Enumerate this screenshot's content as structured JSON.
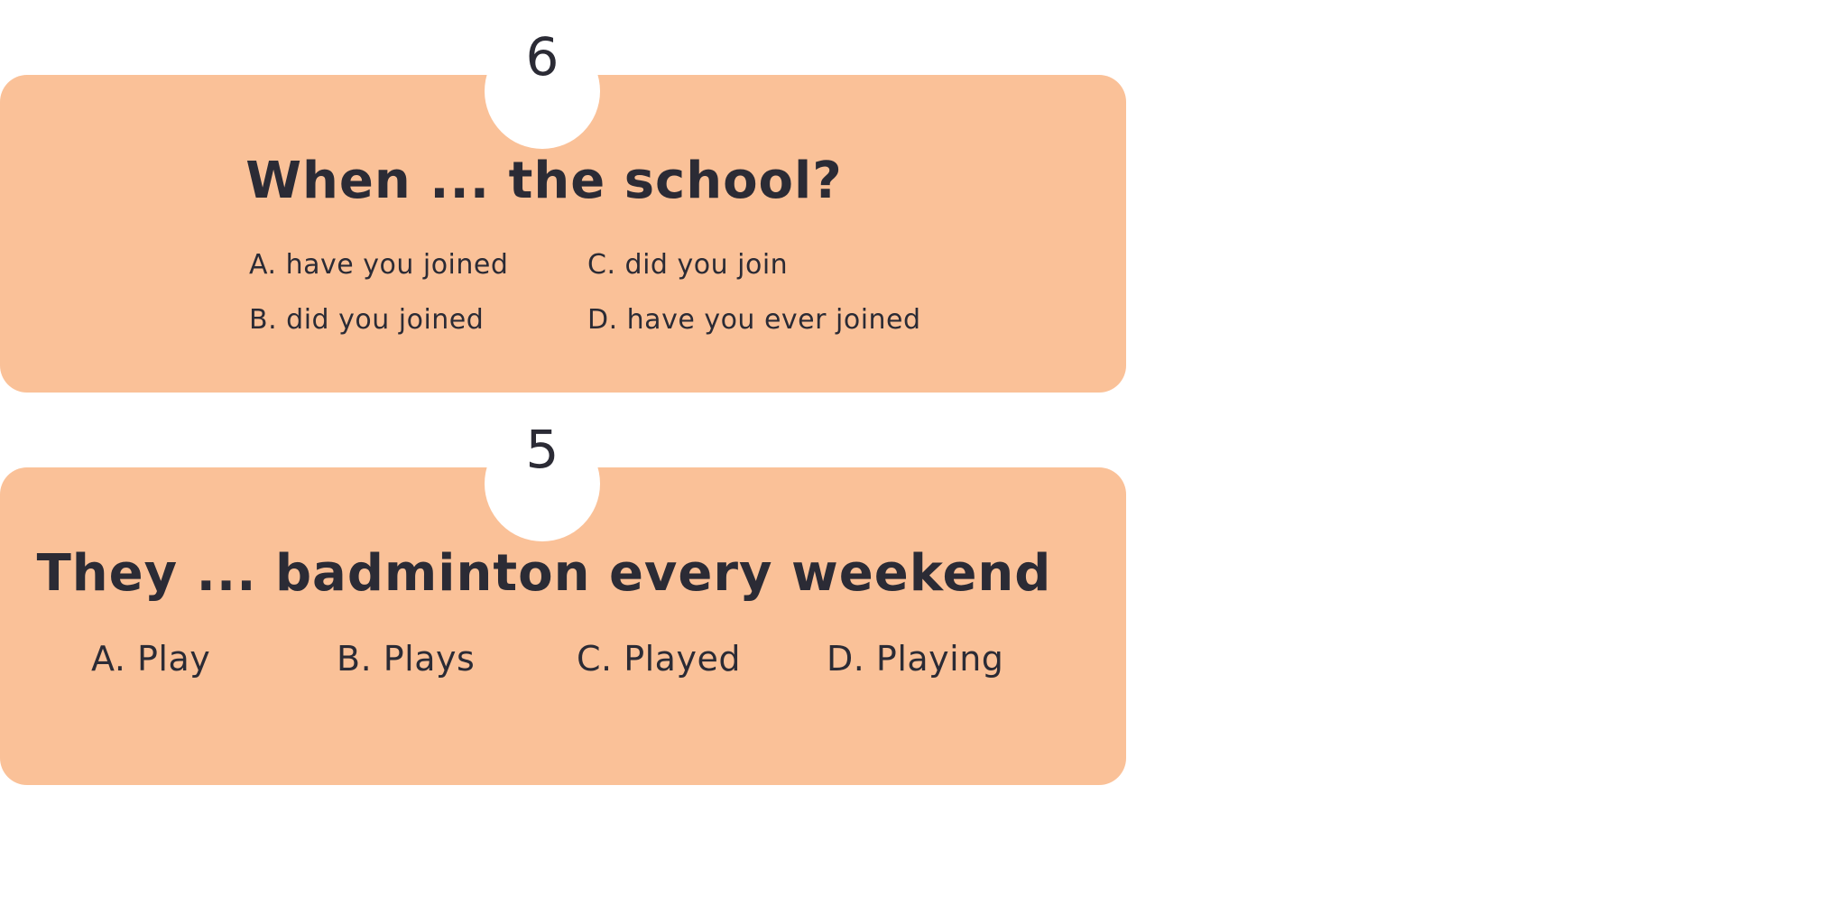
{
  "questions": [
    {
      "number": "6",
      "text": "When ... the school?",
      "options": [
        "A. have you joined",
        "B. did you joined",
        "C. did you join",
        "D. have you ever joined"
      ]
    },
    {
      "number": "5",
      "text": "They ... badminton every weekend",
      "options": [
        "A. Play",
        "B. Plays",
        "C. Played",
        "D. Playing"
      ]
    }
  ],
  "colors": {
    "card_background": "#fac198",
    "text": "#2b2b35",
    "page_background": "#ffffff"
  }
}
